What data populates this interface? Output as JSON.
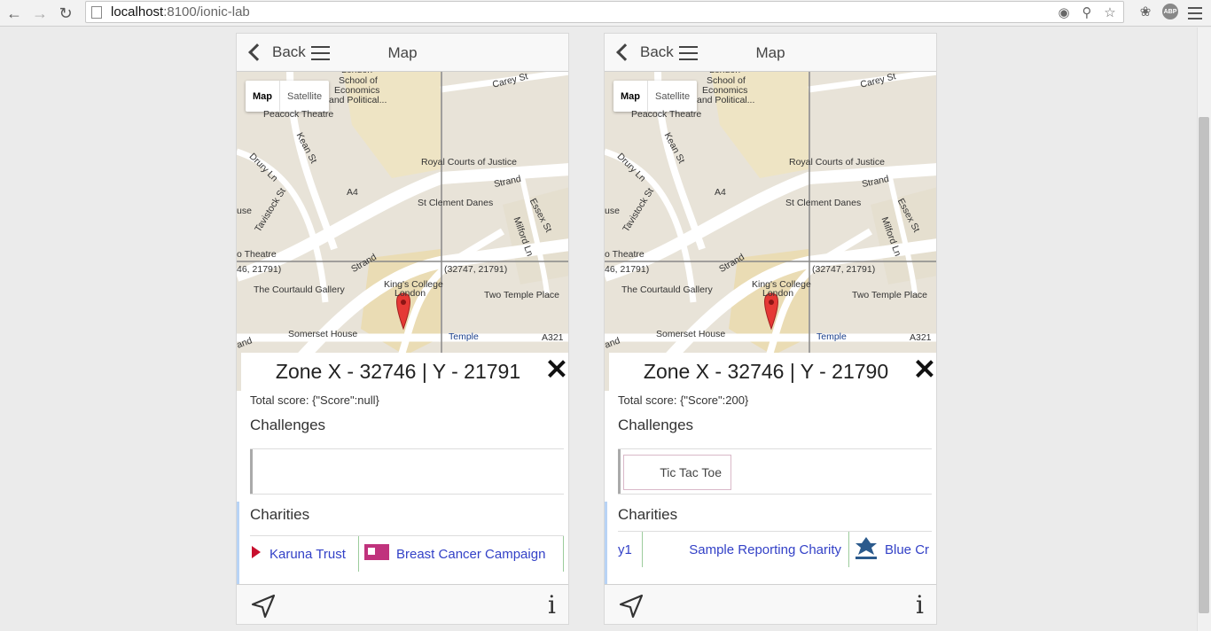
{
  "browser": {
    "url_host": "localhost",
    "url_path": ":8100/ionic-lab",
    "abp_label": "ABP"
  },
  "panels": [
    {
      "toolbar": {
        "back_label": "Back",
        "title": "Map"
      },
      "map": {
        "map_btn": "Map",
        "satellite_btn": "Satellite",
        "labels": [
          "London",
          "School of",
          "Economics",
          "and Political...",
          "Carey St",
          "Peacock Theatre",
          "Kean St",
          "Drury Ln",
          "Royal Courts of Justice",
          "A4",
          "Strand",
          "St Clement Danes",
          "Essex St",
          "Tavistock St",
          "Milford Ln",
          "use",
          "o Theatre",
          "46, 21791)",
          "(32747, 21791)",
          "Strand",
          "The Courtauld Gallery",
          "King's College",
          "London",
          "Two Temple Place",
          "Somerset House",
          "Temple",
          "A321",
          "and"
        ]
      },
      "modal": {
        "title": "Zone X - 32746 | Y - 21791",
        "score": "Total score: {\"Score\":null}",
        "challenges_title": "Challenges",
        "challenges": [],
        "charities_title": "Charities",
        "charities": [
          "Karuna Trust",
          "Breast Cancer Campaign"
        ]
      }
    },
    {
      "toolbar": {
        "back_label": "Back",
        "title": "Map"
      },
      "map": {
        "map_btn": "Map",
        "satellite_btn": "Satellite",
        "labels": [
          "London",
          "School of",
          "Economics",
          "and Political...",
          "Carey St",
          "Peacock Theatre",
          "Kean St",
          "Drury Ln",
          "Royal Courts of Justice",
          "A4",
          "Strand",
          "St Clement Danes",
          "Essex St",
          "Tavistock St",
          "Milford Ln",
          "use",
          "o Theatre",
          "46, 21791)",
          "(32747, 21791)",
          "Strand",
          "The Courtauld Gallery",
          "King's College",
          "London",
          "Two Temple Place",
          "Somerset House",
          "Temple",
          "A321",
          "and"
        ]
      },
      "modal": {
        "title": "Zone X - 32746 | Y - 21790",
        "score": "Total score: {\"Score\":200}",
        "challenges_title": "Challenges",
        "challenges": [
          "Tic Tac Toe"
        ],
        "charities_title": "Charities",
        "charities": [
          "y1",
          "Sample Reporting Charity",
          "Blue Cr"
        ]
      }
    }
  ],
  "colors": {
    "link": "#3341c7",
    "accent_edge": "#b8d3f5",
    "marker": "#e53935"
  }
}
